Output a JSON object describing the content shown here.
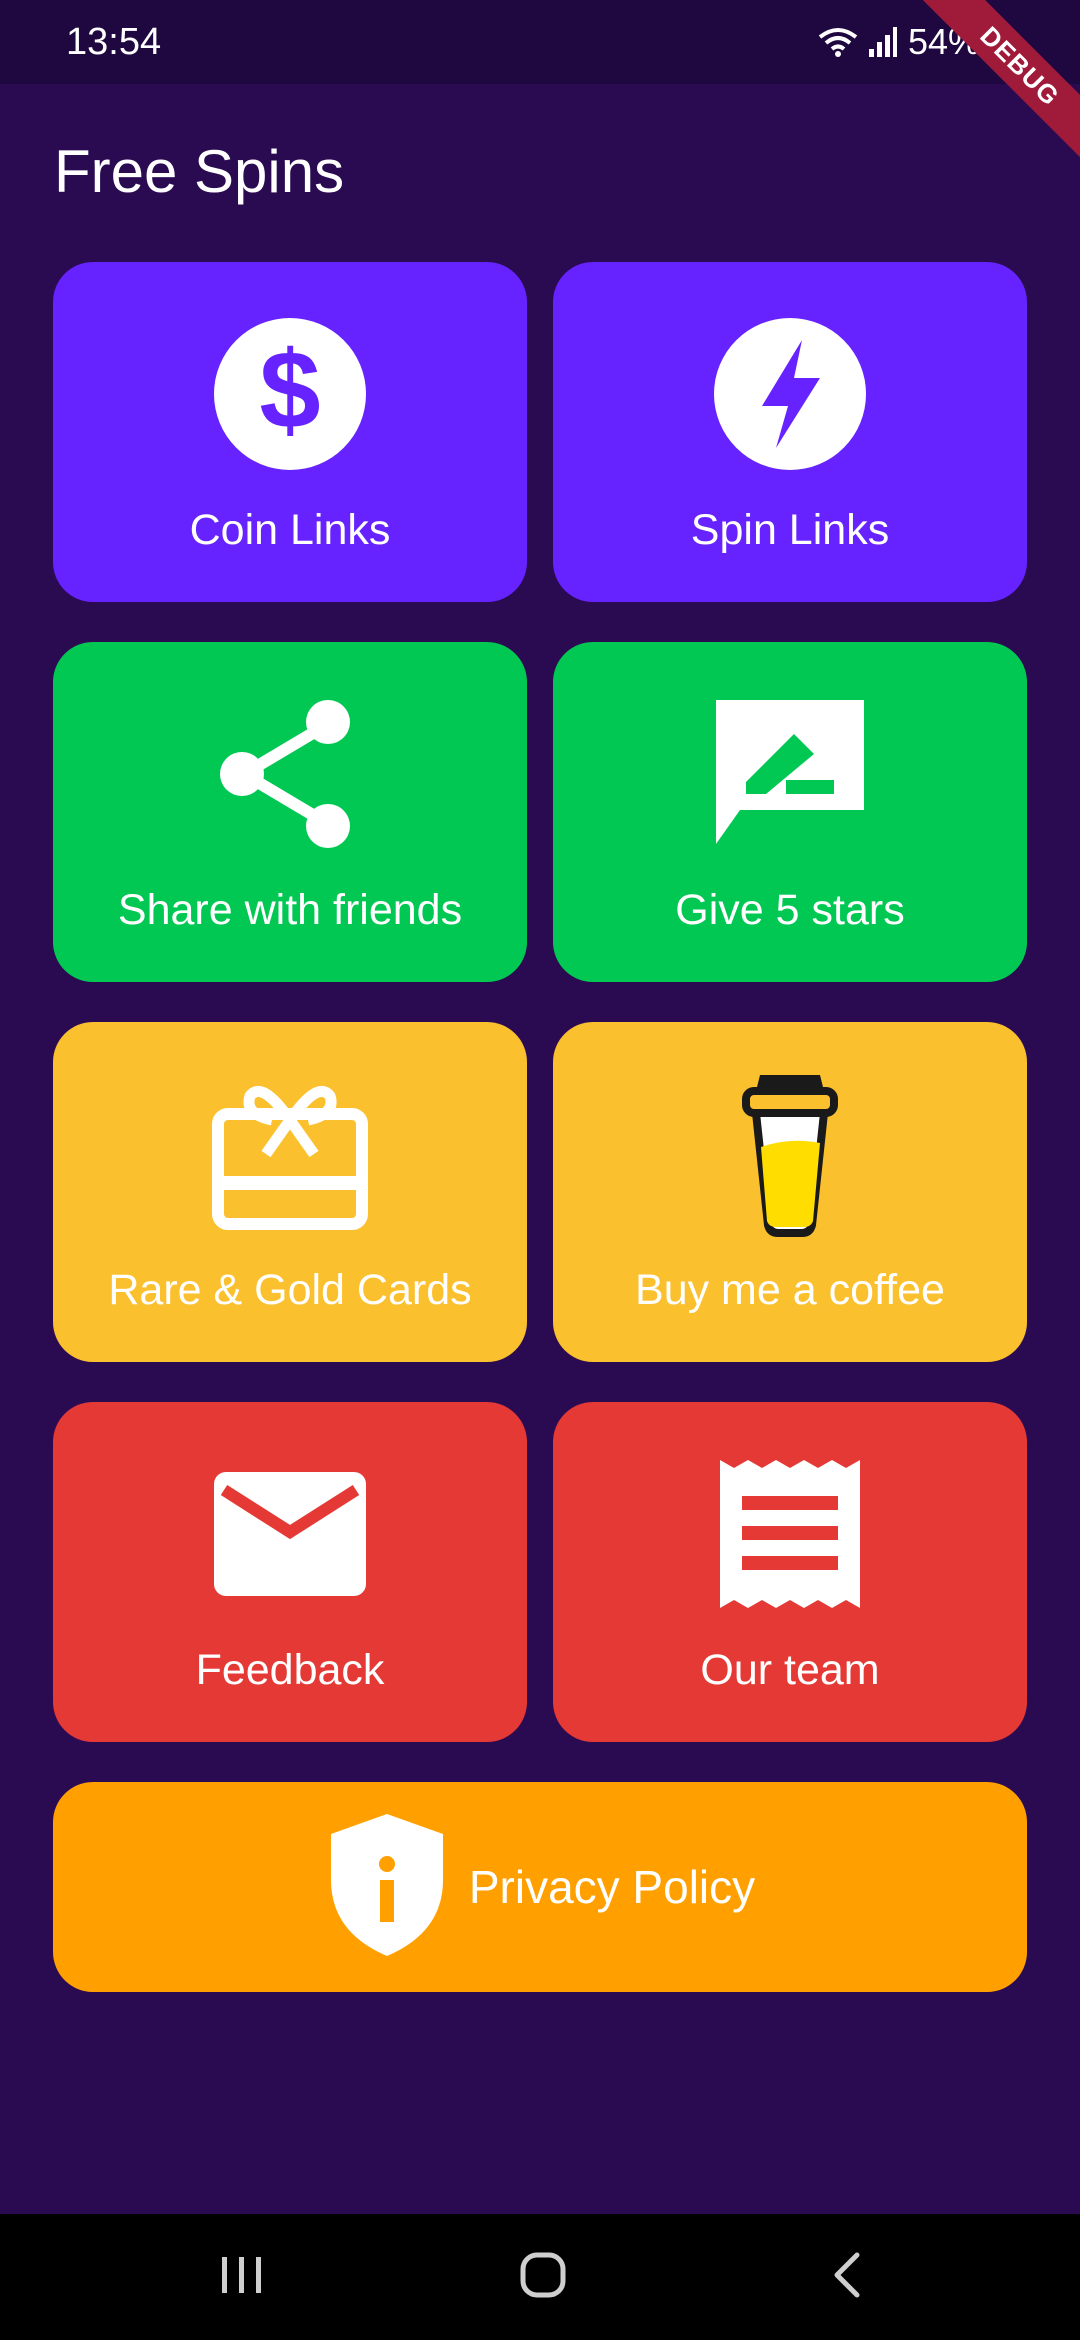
{
  "status_bar": {
    "time": "13:54",
    "battery": "54%",
    "debug_label": "DEBUG"
  },
  "page": {
    "title": "Free Spins"
  },
  "tiles": [
    {
      "label": "Coin Links",
      "icon": "dollar-icon",
      "color": "#6623ff"
    },
    {
      "label": "Spin Links",
      "icon": "lightning-icon",
      "color": "#6623ff"
    },
    {
      "label": "Share with friends",
      "icon": "share-icon",
      "color": "#00c853"
    },
    {
      "label": "Give 5 stars",
      "icon": "rate-review-icon",
      "color": "#00c853"
    },
    {
      "label": "Rare & Gold Cards",
      "icon": "gift-card-icon",
      "color": "#fbc02d"
    },
    {
      "label": "Buy me a coffee",
      "icon": "coffee-cup-icon",
      "color": "#fbc02d"
    },
    {
      "label": "Feedback",
      "icon": "mail-icon",
      "color": "#e53935"
    },
    {
      "label": "Our team",
      "icon": "receipt-icon",
      "color": "#e53935"
    }
  ],
  "privacy": {
    "label": "Privacy Policy",
    "icon": "shield-info-icon",
    "color": "#ffa000"
  },
  "nav_bar": {
    "recents_icon": "recents-icon",
    "home_icon": "home-icon",
    "back_icon": "back-icon"
  },
  "colors": {
    "background": "#2a0b52",
    "status_bar": "#1f0840"
  }
}
